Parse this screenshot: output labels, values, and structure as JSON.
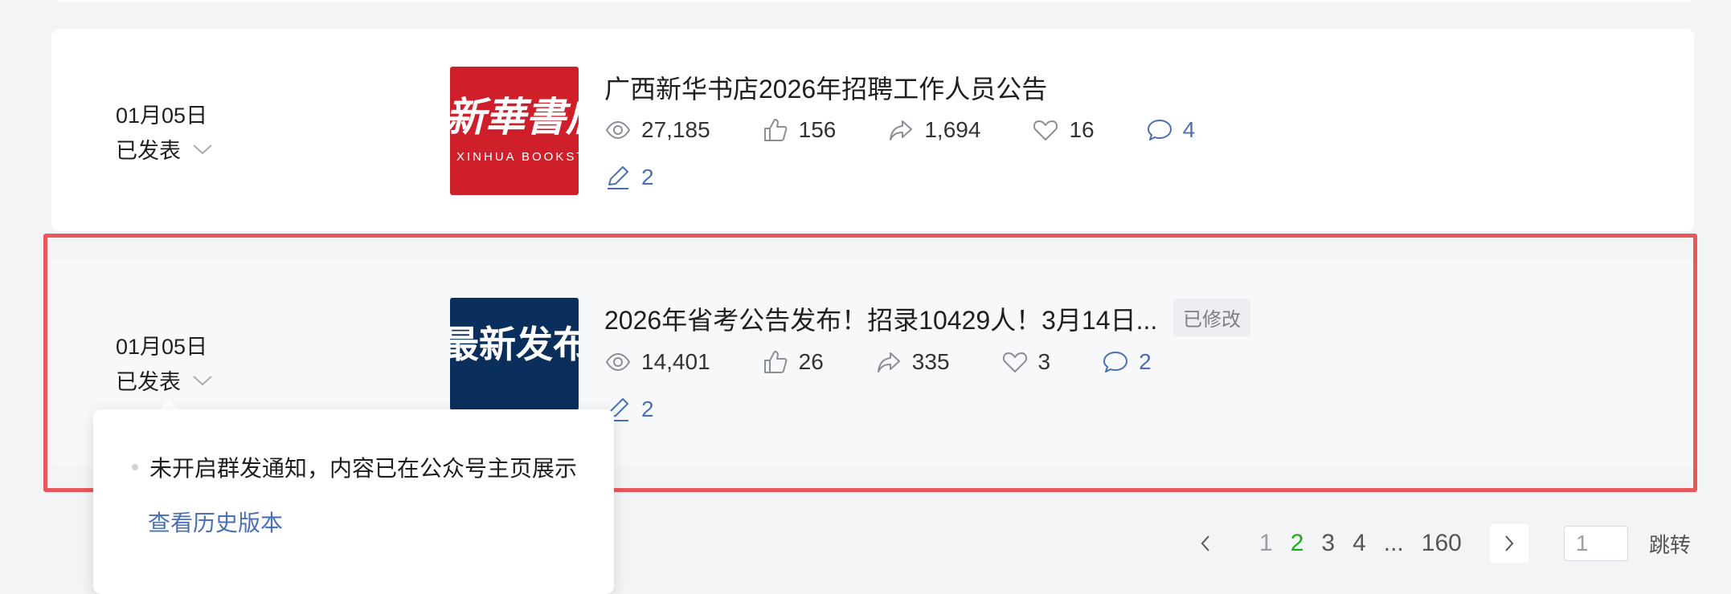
{
  "articles": [
    {
      "date": "01月05日",
      "status": "已发表",
      "title": "广西新华书店2026年招聘工作人员公告",
      "thumb_text": "新華書店",
      "thumb_sub": "XINHUA BOOKSTORE",
      "stats": {
        "views": "27,185",
        "likes": "156",
        "shares": "1,694",
        "favorites": "16",
        "comments": "4",
        "edits": "2"
      }
    },
    {
      "date": "01月05日",
      "status": "已发表",
      "title": "2026年省考公告发布！招录10429人！3月14日...",
      "badge": "已修改",
      "thumb_text": "最新发布",
      "stats": {
        "views": "14,401",
        "likes": "26",
        "shares": "335",
        "favorites": "3",
        "comments": "2",
        "edits": "2"
      }
    }
  ],
  "popup": {
    "note": "未开启群发通知，内容已在公众号主页展示",
    "link": "查看历史版本"
  },
  "pagination": {
    "pages": [
      "1",
      "2",
      "3",
      "4",
      "...",
      "160"
    ],
    "current": "2",
    "jump_value": "1",
    "jump_label": "跳转"
  },
  "colors": {
    "accent": "#1aad19",
    "link": "#4a6fb5",
    "highlight": "#e8575a"
  }
}
